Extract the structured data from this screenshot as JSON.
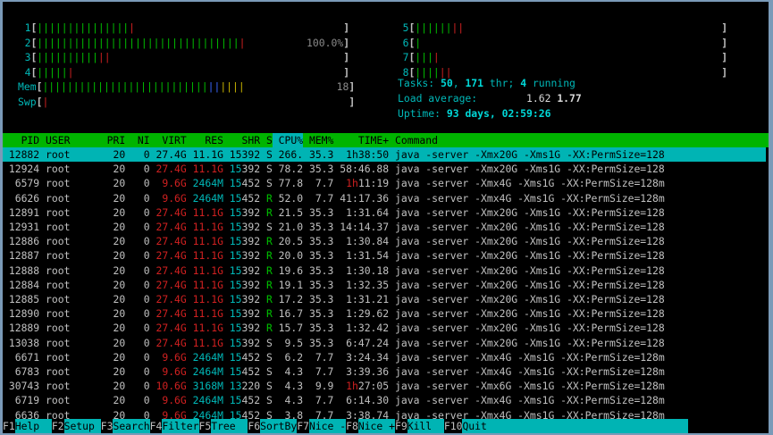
{
  "cpus": [
    {
      "label": "1",
      "segments": [
        {
          "c": "g",
          "n": 15
        },
        {
          "c": "r",
          "n": 1
        }
      ],
      "value": ""
    },
    {
      "label": "2",
      "segments": [
        {
          "c": "g",
          "n": 33
        },
        {
          "c": "r",
          "n": 1
        }
      ],
      "value": "100.0%"
    },
    {
      "label": "3",
      "segments": [
        {
          "c": "g",
          "n": 10
        },
        {
          "c": "r",
          "n": 2
        }
      ],
      "value": ""
    },
    {
      "label": "4",
      "segments": [
        {
          "c": "g",
          "n": 5
        },
        {
          "c": "r",
          "n": 1
        }
      ],
      "value": ""
    },
    {
      "label": "5",
      "segments": [
        {
          "c": "g",
          "n": 6
        },
        {
          "c": "r",
          "n": 2
        }
      ],
      "value": ""
    },
    {
      "label": "6",
      "segments": [
        {
          "c": "g",
          "n": 1
        }
      ],
      "value": ""
    },
    {
      "label": "7",
      "segments": [
        {
          "c": "g",
          "n": 3
        },
        {
          "c": "r",
          "n": 1
        }
      ],
      "value": ""
    },
    {
      "label": "8",
      "segments": [
        {
          "c": "g",
          "n": 4
        },
        {
          "c": "r",
          "n": 2
        }
      ],
      "value": ""
    }
  ],
  "mem": {
    "label": "Mem",
    "segments": [
      {
        "c": "g",
        "n": 27
      },
      {
        "c": "b",
        "n": 2
      },
      {
        "c": "y",
        "n": 4
      }
    ],
    "value": "18"
  },
  "swp": {
    "label": "Swp",
    "segments": [
      {
        "c": "r",
        "n": 1
      }
    ],
    "value": ""
  },
  "tasks": {
    "label": "Tasks: ",
    "tasks": "50",
    "sep1": ", ",
    "threads": "171",
    "thr": " thr; ",
    "running": "4",
    "run_label": " running"
  },
  "load": {
    "label": "Load average: ",
    "one": "1.62",
    "five": "1.77"
  },
  "uptime": {
    "label": "Uptime: ",
    "value": "93 days, 02:59:26"
  },
  "columns": [
    "PID",
    "USER",
    "PRI",
    "NI",
    "VIRT",
    "RES",
    "SHR",
    "S",
    "CPU%",
    "MEM%",
    "TIME+",
    "Command"
  ],
  "processes": [
    {
      "pid": "12882",
      "user": "root",
      "pri": "20",
      "ni": "0",
      "virt": "27.4G",
      "res": "11.1G",
      "shr": "15392",
      "s": "S",
      "cpu": "266.",
      "mem": "35.3",
      "time_h": "1h",
      "time": "38:50",
      "cmd": "java -server -Xmx20G -Xms1G -XX:PermSize=128"
    },
    {
      "pid": "12924",
      "user": "root",
      "pri": "20",
      "ni": "0",
      "virt": "27.4G",
      "res": "11.1G",
      "shr": "15392",
      "s": "S",
      "cpu": "78.2",
      "mem": "35.3",
      "time_h": "",
      "time": "58:46.88",
      "cmd": "java -server -Xmx20G -Xms1G -XX:PermSize=128"
    },
    {
      "pid": "6579",
      "user": "root",
      "pri": "20",
      "ni": "0",
      "virt": "9.6G",
      "res": "2464M",
      "shr": "15452",
      "s": "S",
      "cpu": "77.8",
      "mem": "7.7",
      "time_h": "1h",
      "time": "11:19",
      "cmd": "java -server -Xmx4G -Xms1G -XX:PermSize=128m"
    },
    {
      "pid": "6626",
      "user": "root",
      "pri": "20",
      "ni": "0",
      "virt": "9.6G",
      "res": "2464M",
      "shr": "15452",
      "s": "R",
      "cpu": "52.0",
      "mem": "7.7",
      "time_h": "",
      "time": "41:17.36",
      "cmd": "java -server -Xmx4G -Xms1G -XX:PermSize=128m"
    },
    {
      "pid": "12891",
      "user": "root",
      "pri": "20",
      "ni": "0",
      "virt": "27.4G",
      "res": "11.1G",
      "shr": "15392",
      "s": "R",
      "cpu": "21.5",
      "mem": "35.3",
      "time_h": "",
      "time": "1:31.64",
      "cmd": "java -server -Xmx20G -Xms1G -XX:PermSize=128"
    },
    {
      "pid": "12931",
      "user": "root",
      "pri": "20",
      "ni": "0",
      "virt": "27.4G",
      "res": "11.1G",
      "shr": "15392",
      "s": "S",
      "cpu": "21.0",
      "mem": "35.3",
      "time_h": "",
      "time": "14:14.37",
      "cmd": "java -server -Xmx20G -Xms1G -XX:PermSize=128"
    },
    {
      "pid": "12886",
      "user": "root",
      "pri": "20",
      "ni": "0",
      "virt": "27.4G",
      "res": "11.1G",
      "shr": "15392",
      "s": "R",
      "cpu": "20.5",
      "mem": "35.3",
      "time_h": "",
      "time": "1:30.84",
      "cmd": "java -server -Xmx20G -Xms1G -XX:PermSize=128"
    },
    {
      "pid": "12887",
      "user": "root",
      "pri": "20",
      "ni": "0",
      "virt": "27.4G",
      "res": "11.1G",
      "shr": "15392",
      "s": "R",
      "cpu": "20.0",
      "mem": "35.3",
      "time_h": "",
      "time": "1:31.54",
      "cmd": "java -server -Xmx20G -Xms1G -XX:PermSize=128"
    },
    {
      "pid": "12888",
      "user": "root",
      "pri": "20",
      "ni": "0",
      "virt": "27.4G",
      "res": "11.1G",
      "shr": "15392",
      "s": "R",
      "cpu": "19.6",
      "mem": "35.3",
      "time_h": "",
      "time": "1:30.18",
      "cmd": "java -server -Xmx20G -Xms1G -XX:PermSize=128"
    },
    {
      "pid": "12884",
      "user": "root",
      "pri": "20",
      "ni": "0",
      "virt": "27.4G",
      "res": "11.1G",
      "shr": "15392",
      "s": "R",
      "cpu": "19.1",
      "mem": "35.3",
      "time_h": "",
      "time": "1:32.35",
      "cmd": "java -server -Xmx20G -Xms1G -XX:PermSize=128"
    },
    {
      "pid": "12885",
      "user": "root",
      "pri": "20",
      "ni": "0",
      "virt": "27.4G",
      "res": "11.1G",
      "shr": "15392",
      "s": "R",
      "cpu": "17.2",
      "mem": "35.3",
      "time_h": "",
      "time": "1:31.21",
      "cmd": "java -server -Xmx20G -Xms1G -XX:PermSize=128"
    },
    {
      "pid": "12890",
      "user": "root",
      "pri": "20",
      "ni": "0",
      "virt": "27.4G",
      "res": "11.1G",
      "shr": "15392",
      "s": "R",
      "cpu": "16.7",
      "mem": "35.3",
      "time_h": "",
      "time": "1:29.62",
      "cmd": "java -server -Xmx20G -Xms1G -XX:PermSize=128"
    },
    {
      "pid": "12889",
      "user": "root",
      "pri": "20",
      "ni": "0",
      "virt": "27.4G",
      "res": "11.1G",
      "shr": "15392",
      "s": "R",
      "cpu": "15.7",
      "mem": "35.3",
      "time_h": "",
      "time": "1:32.42",
      "cmd": "java -server -Xmx20G -Xms1G -XX:PermSize=128"
    },
    {
      "pid": "13038",
      "user": "root",
      "pri": "20",
      "ni": "0",
      "virt": "27.4G",
      "res": "11.1G",
      "shr": "15392",
      "s": "S",
      "cpu": "9.5",
      "mem": "35.3",
      "time_h": "",
      "time": "6:47.24",
      "cmd": "java -server -Xmx20G -Xms1G -XX:PermSize=128"
    },
    {
      "pid": "6671",
      "user": "root",
      "pri": "20",
      "ni": "0",
      "virt": "9.6G",
      "res": "2464M",
      "shr": "15452",
      "s": "S",
      "cpu": "6.2",
      "mem": "7.7",
      "time_h": "",
      "time": "3:24.34",
      "cmd": "java -server -Xmx4G -Xms1G -XX:PermSize=128m"
    },
    {
      "pid": "6783",
      "user": "root",
      "pri": "20",
      "ni": "0",
      "virt": "9.6G",
      "res": "2464M",
      "shr": "15452",
      "s": "S",
      "cpu": "4.3",
      "mem": "7.7",
      "time_h": "",
      "time": "3:39.36",
      "cmd": "java -server -Xmx4G -Xms1G -XX:PermSize=128m"
    },
    {
      "pid": "30743",
      "user": "root",
      "pri": "20",
      "ni": "0",
      "virt": "10.6G",
      "res": "3168M",
      "shr": "13220",
      "s": "S",
      "cpu": "4.3",
      "mem": "9.9",
      "time_h": "1h",
      "time": "27:05",
      "cmd": "java -server -Xmx6G -Xms1G -XX:PermSize=128m"
    },
    {
      "pid": "6719",
      "user": "root",
      "pri": "20",
      "ni": "0",
      "virt": "9.6G",
      "res": "2464M",
      "shr": "15452",
      "s": "S",
      "cpu": "4.3",
      "mem": "7.7",
      "time_h": "",
      "time": "6:14.30",
      "cmd": "java -server -Xmx4G -Xms1G -XX:PermSize=128m"
    },
    {
      "pid": "6636",
      "user": "root",
      "pri": "20",
      "ni": "0",
      "virt": "9.6G",
      "res": "2464M",
      "shr": "15452",
      "s": "S",
      "cpu": "3.8",
      "mem": "7.7",
      "time_h": "",
      "time": "3:38.74",
      "cmd": "java -server -Xmx4G -Xms1G -XX:PermSize=128m"
    }
  ],
  "fkeys": [
    {
      "key": "F1",
      "label": "Help  "
    },
    {
      "key": "F2",
      "label": "Setup "
    },
    {
      "key": "F3",
      "label": "Search"
    },
    {
      "key": "F4",
      "label": "Filter"
    },
    {
      "key": "F5",
      "label": "Tree  "
    },
    {
      "key": "F6",
      "label": "SortBy"
    },
    {
      "key": "F7",
      "label": "Nice -"
    },
    {
      "key": "F8",
      "label": "Nice +"
    },
    {
      "key": "F9",
      "label": "Kill  "
    },
    {
      "key": "F10",
      "label": "Quit"
    }
  ],
  "colors": {
    "header_bg": "#00b400",
    "selected_bg": "#00b4b4",
    "red": "#d02020",
    "green": "#00c000",
    "cyan": "#00b8b8"
  }
}
